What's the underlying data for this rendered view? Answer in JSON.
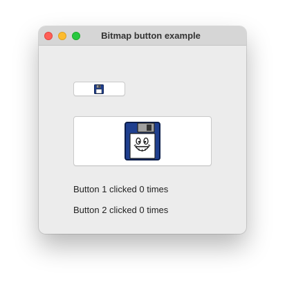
{
  "window": {
    "title": "Bitmap button example"
  },
  "buttons": [
    {
      "icon": "floppy-disk-icon"
    },
    {
      "icon": "smiling-floppy-disk-icon"
    }
  ],
  "labels": {
    "button1": "Button 1 clicked 0 times",
    "button2": "Button 2 clicked 0 times"
  },
  "colors": {
    "close": "#ff5f57",
    "minimize": "#febc2e",
    "zoom": "#28c840",
    "floppy_blue": "#1f3f8f"
  }
}
